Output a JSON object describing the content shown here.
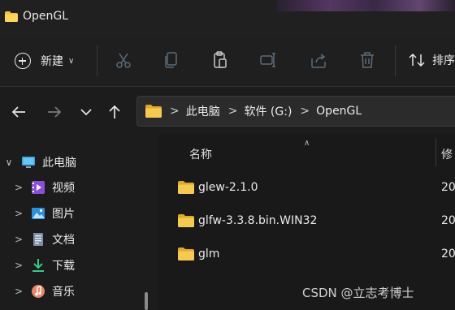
{
  "window": {
    "title": "OpenGL"
  },
  "toolbar": {
    "new_label": "新建",
    "sort_label": "排序",
    "icons": [
      "scissors-icon",
      "copy-icon",
      "paste-icon",
      "rename-icon",
      "share-icon",
      "delete-icon"
    ]
  },
  "nav": {
    "breadcrumb": [
      "此电脑",
      "软件 (G:)",
      "OpenGL"
    ]
  },
  "sidebar": {
    "items": [
      {
        "label": "此电脑",
        "icon": "computer-icon",
        "expanded": true
      },
      {
        "label": "视频",
        "icon": "video-icon"
      },
      {
        "label": "图片",
        "icon": "picture-icon"
      },
      {
        "label": "文档",
        "icon": "document-icon"
      },
      {
        "label": "下载",
        "icon": "download-icon"
      },
      {
        "label": "音乐",
        "icon": "music-icon"
      }
    ]
  },
  "content": {
    "columns": {
      "name": "名称",
      "date": "修"
    },
    "rows": [
      {
        "name": "glew-2.1.0",
        "date": "20"
      },
      {
        "name": "glfw-3.3.8.bin.WIN32",
        "date": "20"
      },
      {
        "name": "glm",
        "date": "20"
      }
    ]
  },
  "watermark": "CSDN @立志考博士",
  "colors": {
    "folder": "#f4c34a",
    "background": "#1c1c1c",
    "accent": "#2b8ed6"
  }
}
